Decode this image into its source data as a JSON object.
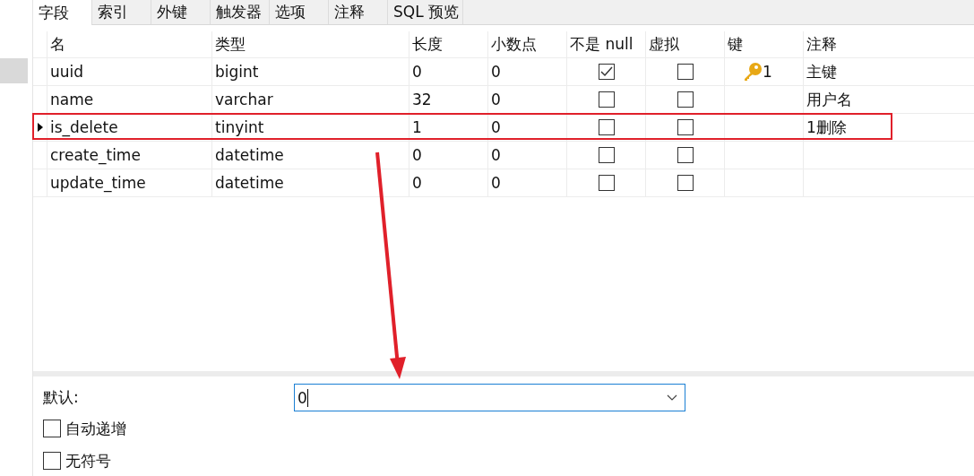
{
  "tabs": [
    {
      "label": "字段",
      "selected": true
    },
    {
      "label": "索引",
      "selected": false
    },
    {
      "label": "外键",
      "selected": false
    },
    {
      "label": "触发器",
      "selected": false
    },
    {
      "label": "选项",
      "selected": false
    },
    {
      "label": "注释",
      "selected": false
    },
    {
      "label": "SQL 预览",
      "selected": false
    }
  ],
  "table": {
    "columns": [
      "名",
      "类型",
      "长度",
      "小数点",
      "不是 null",
      "虚拟",
      "键",
      "注释"
    ],
    "rows": [
      {
        "name": "uuid",
        "type": "bigint",
        "length": "0",
        "decimals": "0",
        "not_null": true,
        "virtual": false,
        "key": "1",
        "comment": "主键",
        "current": false,
        "annotated": false
      },
      {
        "name": "name",
        "type": "varchar",
        "length": "32",
        "decimals": "0",
        "not_null": false,
        "virtual": false,
        "comment": "用户名",
        "current": false,
        "annotated": false
      },
      {
        "name": "is_delete",
        "type": "tinyint",
        "length": "1",
        "decimals": "0",
        "not_null": false,
        "virtual": false,
        "comment": "1删除",
        "current": true,
        "annotated": true
      },
      {
        "name": "create_time",
        "type": "datetime",
        "length": "0",
        "decimals": "0",
        "not_null": false,
        "virtual": false,
        "current": false,
        "annotated": false
      },
      {
        "name": "update_time",
        "type": "datetime",
        "length": "0",
        "decimals": "0",
        "not_null": false,
        "virtual": false,
        "current": false,
        "annotated": false
      }
    ]
  },
  "properties": {
    "default_label": "默认:",
    "default_value": "0",
    "options": [
      {
        "label": "自动递增",
        "checked": false
      },
      {
        "label": "无符号",
        "checked": false
      }
    ]
  }
}
